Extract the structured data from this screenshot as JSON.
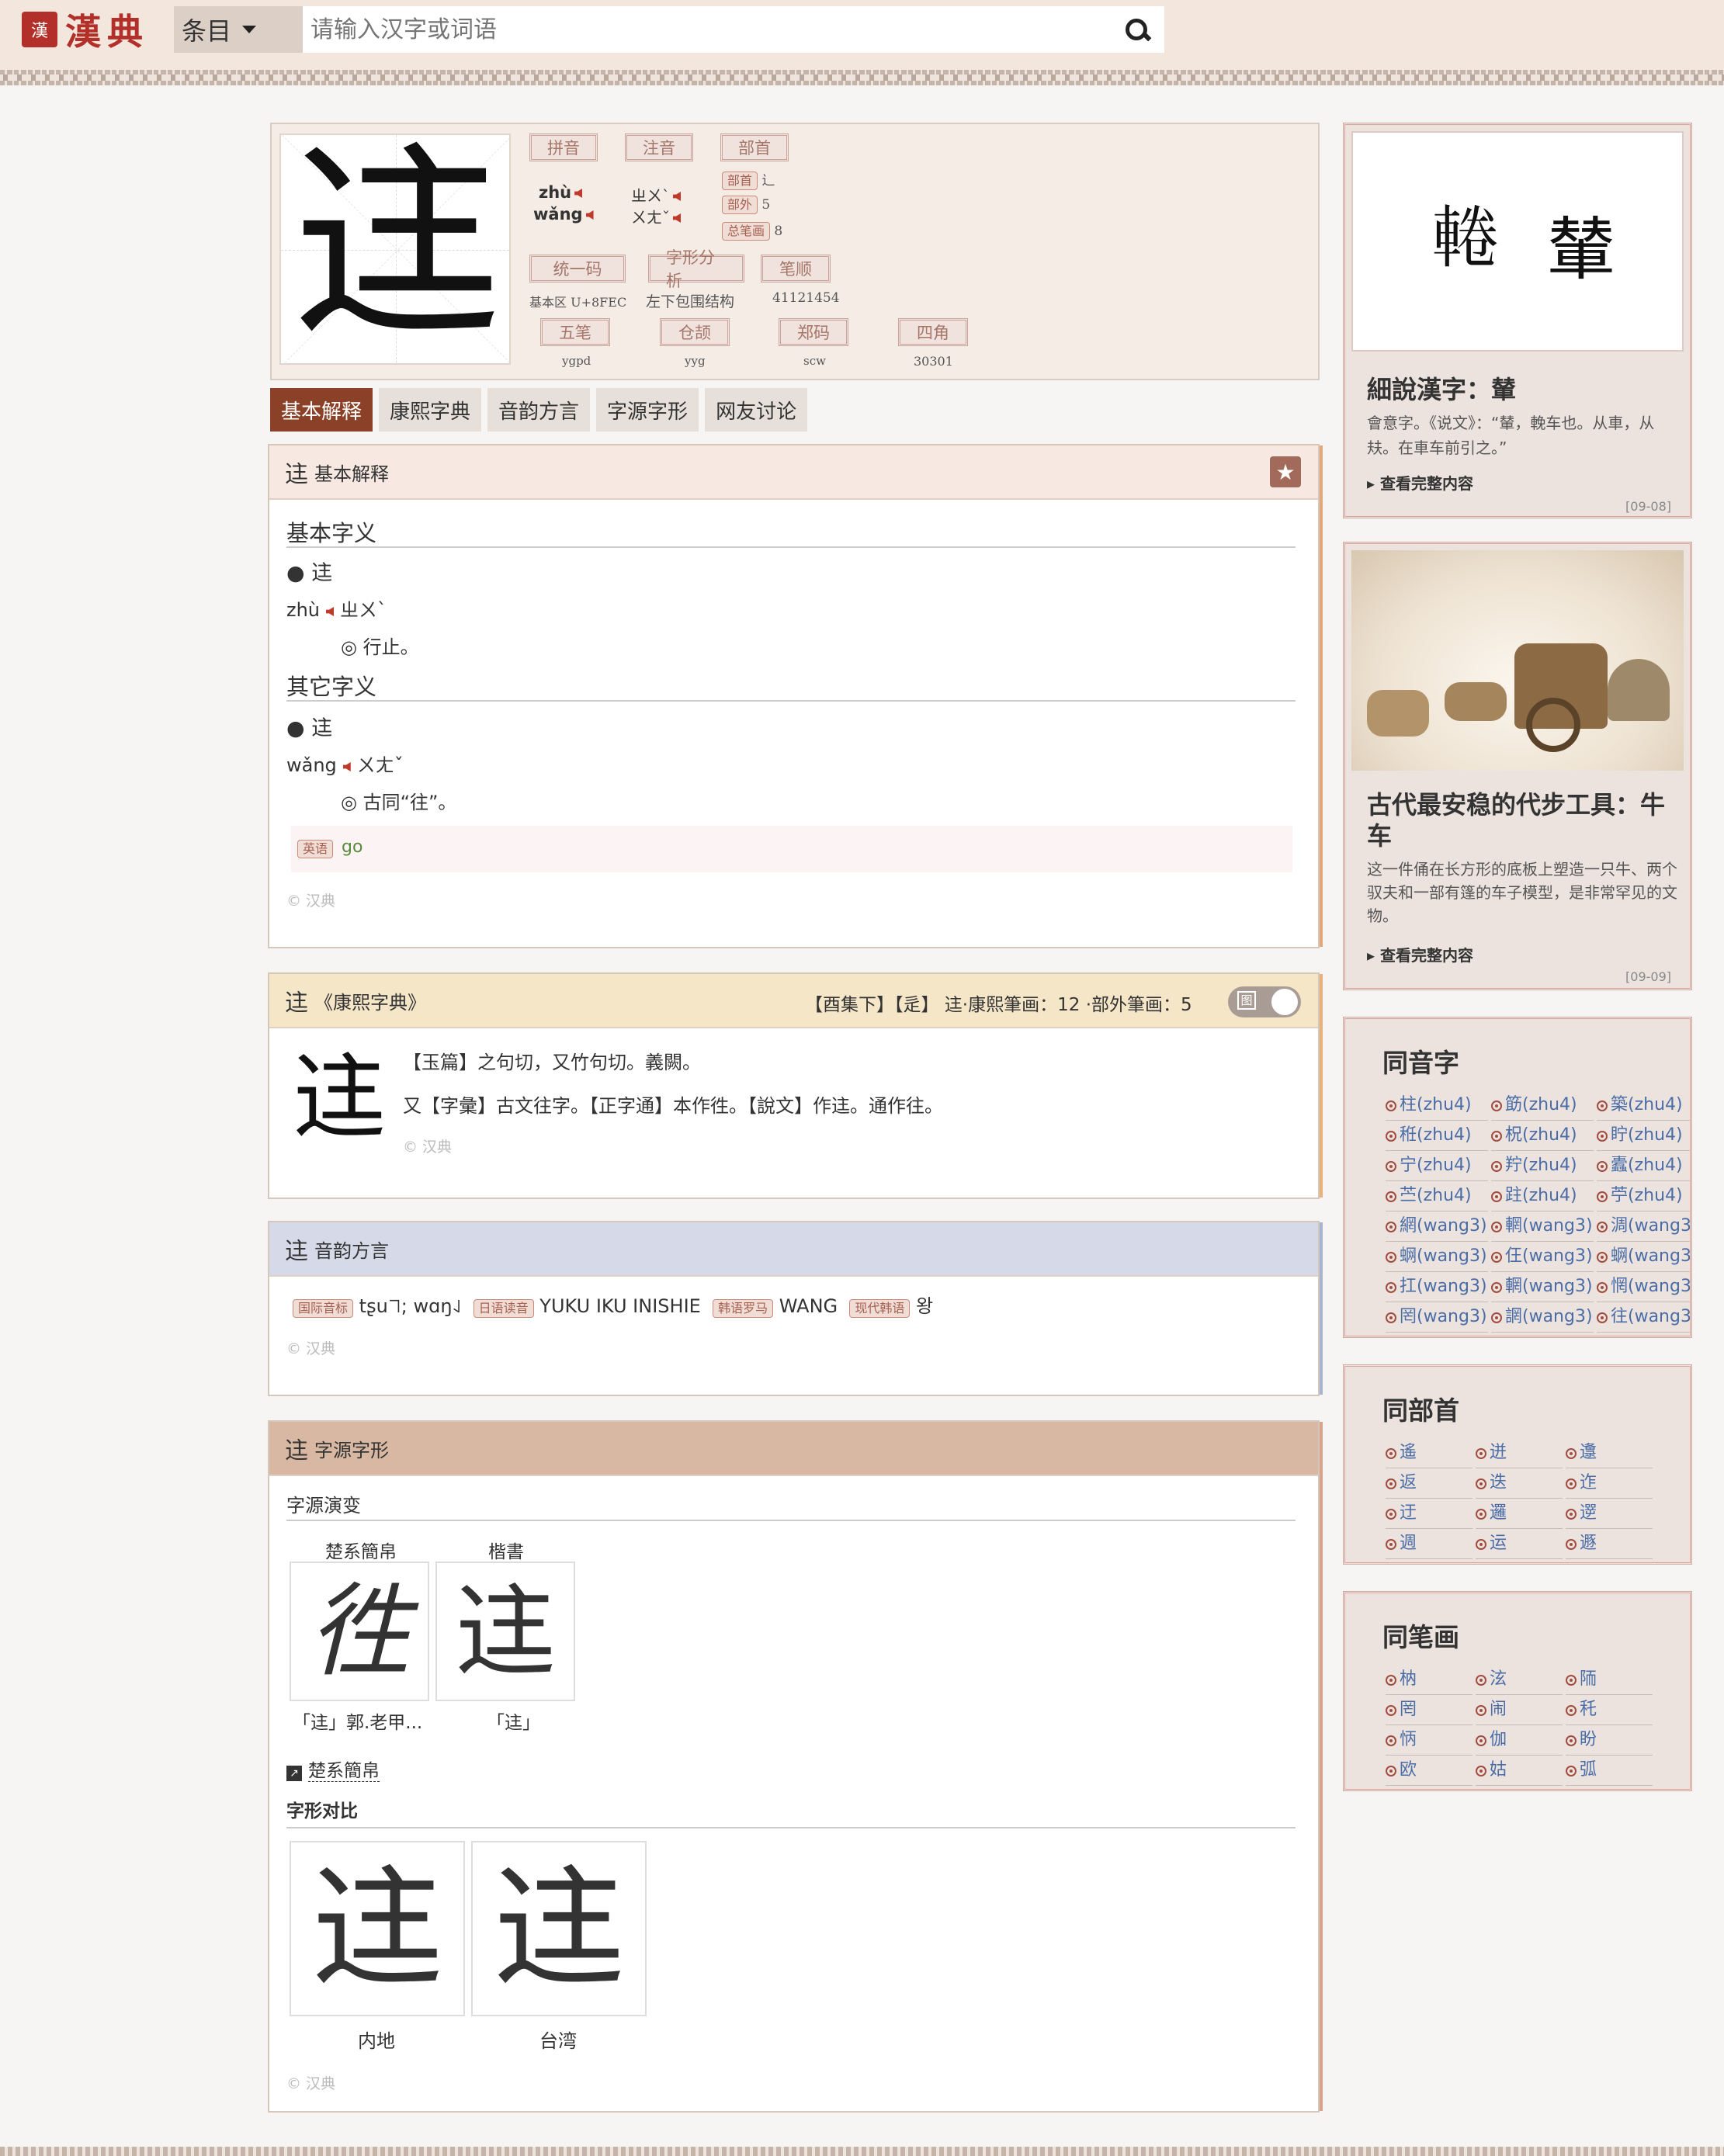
{
  "header": {
    "logo_seal": "漢",
    "logo_text": "漢典",
    "select_label": "条目",
    "search_placeholder": "请输入汉字或词语"
  },
  "char": {
    "glyph": "迬",
    "labels": {
      "pinyin": "拼音",
      "zhuyin": "注音",
      "bushou": "部首",
      "unicode": "统一码",
      "structure": "字形分析",
      "bishun": "笔顺",
      "wubi": "五笔",
      "cangjie": "仓颉",
      "zhengma": "郑码",
      "sijiao": "四角"
    },
    "pinyin": [
      "zhù",
      "wǎng"
    ],
    "zhuyin": [
      "ㄓㄨˋ",
      "ㄨㄤˇ"
    ],
    "radical_label": "部首",
    "radical": "辶",
    "outer_label": "部外",
    "outer": "5",
    "total_label": "总笔画",
    "total": "8",
    "unicode": "基本区 U+8FEC",
    "structure": "左下包围结构",
    "bishun": "41121454",
    "wubi": "ygpd",
    "cangjie": "yyg",
    "zhengma": "scw",
    "sijiao": "30301"
  },
  "tabs": [
    "基本解释",
    "康熙字典",
    "音韵方言",
    "字源字形",
    "网友讨论"
  ],
  "basic": {
    "title_char": "迬",
    "title": "基本解释",
    "basic_head": "基本字义",
    "b1": "● 迬",
    "b1_py": "zhù",
    "b1_zy": "ㄓㄨˋ",
    "b1_def": "◎ 行止。",
    "other_head": "其它字义",
    "o1": "● 迬",
    "o1_py": "wǎng",
    "o1_zy": "ㄨㄤˇ",
    "o1_def": "◎ 古同“往”。",
    "en_badge": "英语",
    "en": "go",
    "copy": "© 汉典"
  },
  "kangxi": {
    "title_char": "迬",
    "title": "《康熙字典》",
    "meta": "【酉集下】【辵】 迬·康熙筆画：12 ·部外筆画：5",
    "toggle": "图",
    "glyph": "迬",
    "l1": "【玉篇】之句切，又竹句切。義闕。",
    "l2": "又【字彙】古文往字。【正字通】本作徃。【說文】作迬。通作往。",
    "copy": "© 汉典"
  },
  "yinyun": {
    "title_char": "迬",
    "title": "音韵方言",
    "ipa_b": "国际音标",
    "ipa": "tʂu˥˥; wɑŋ˨˩",
    "jp_b": "日语读音",
    "jp": "YUKU IKU INISHIE",
    "kr_b": "韩语罗马",
    "kr": "WANG",
    "hg_b": "现代韩语",
    "hg": "왕",
    "copy": "© 汉典"
  },
  "ziyuan": {
    "title_char": "迬",
    "title": "字源字形",
    "evo_head": "字源演变",
    "c1_label": "楚系簡帛",
    "c1_glyph": "徃",
    "c1_cap": "「迬」郭.老甲...",
    "c2_label": "楷書",
    "c2_glyph": "迬",
    "c2_cap": "「迬」",
    "link": "楚系簡帛",
    "cmp_head": "字形对比",
    "m1": "迬",
    "m1_cap": "内地",
    "m2": "迬",
    "m2_cap": "台湾",
    "copy": "© 汉典"
  },
  "side1": {
    "glyph1": "𨌫",
    "glyph2": "輦",
    "title": "細說漢字：輦",
    "body": "會意字。《说文》：“輦，輓车也。从車，从㚘。在車车前引之。”",
    "more": "查看完整内容",
    "date": "[09-08]"
  },
  "side2": {
    "title": "古代最安稳的代步工具：牛车",
    "body": "这一件俑在长方形的底板上塑造一只牛、两个驭夫和一部有篷的车子模型，是非常罕见的文物。",
    "more": "查看完整内容",
    "date": "[09-09]"
  },
  "tongyin": {
    "title": "同音字",
    "items": [
      "柱(zhu4)",
      "筯(zhu4)",
      "築(zhu4)",
      "秹(zhu4)",
      "柷(zhu4)",
      "眝(zhu4)",
      "宁(zhu4)",
      "羜(zhu4)",
      "蠹(zhu4)",
      "苎(zhu4)",
      "跓(zhu4)",
      "苧(zhu4)",
      "網(wang3)",
      "輞(wang3)",
      "淍(wang3)",
      "蛧(wang3)",
      "仼(wang3)",
      "蛧(wang3)",
      "扛(wang3)",
      "輞(wang3)",
      "惘(wang3)",
      "罔(wang3)",
      "誷(wang3)",
      "往(wang3)"
    ]
  },
  "tongbu": {
    "title": "同部首",
    "items": [
      "遙",
      "迸",
      "邍",
      "返",
      "迭",
      "迮",
      "迂",
      "邏",
      "遻",
      "週",
      "运",
      "遯"
    ]
  },
  "tongbi": {
    "title": "同笔画",
    "items": [
      "枘",
      "泫",
      "陑",
      "罔",
      "闹",
      "秅",
      "怲",
      "伽",
      "盼",
      "欧",
      "姑",
      "弧"
    ]
  }
}
